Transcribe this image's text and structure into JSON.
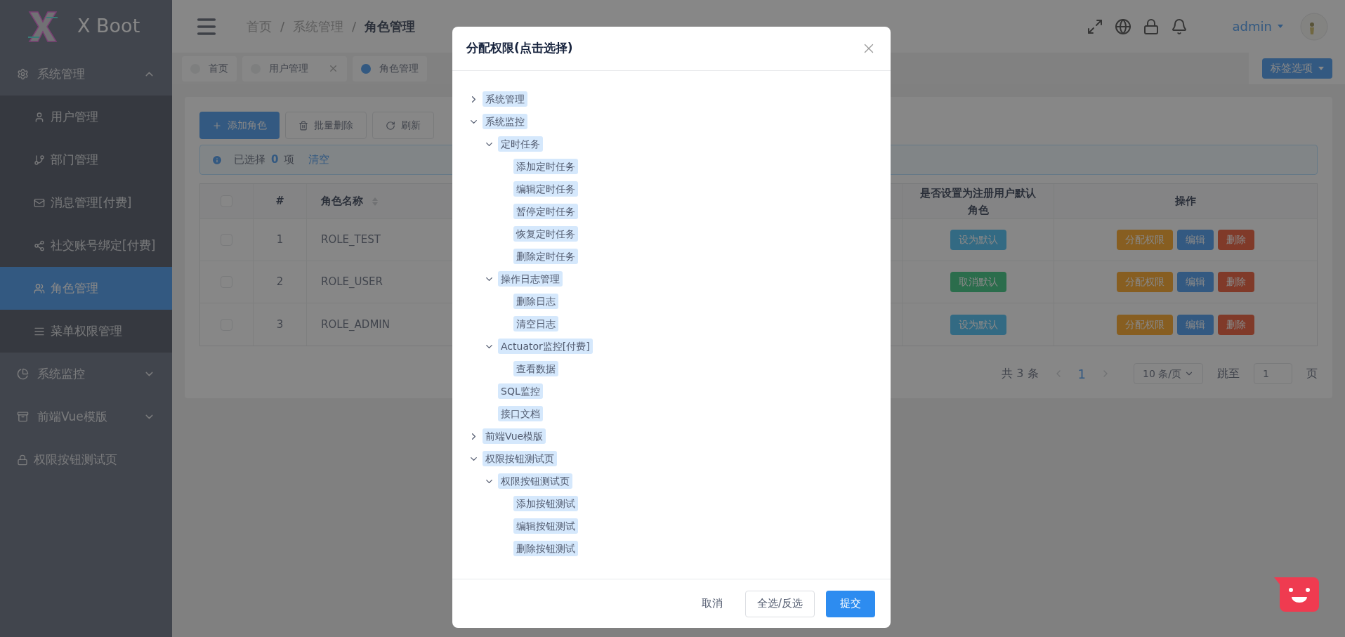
{
  "sidebar": {
    "logo": "X Boot",
    "items": [
      {
        "kind": "group",
        "label": "系统管理",
        "expanded": true,
        "children": [
          {
            "label": "用户管理",
            "selected": false
          },
          {
            "label": "部门管理",
            "selected": false
          },
          {
            "label": "消息管理[付费]",
            "selected": false
          },
          {
            "label": "社交账号绑定[付费]",
            "selected": false
          },
          {
            "label": "角色管理",
            "selected": true
          },
          {
            "label": "菜单权限管理",
            "selected": false
          }
        ]
      },
      {
        "kind": "group",
        "label": "系统监控",
        "expanded": false
      },
      {
        "kind": "group",
        "label": "前端Vue模版",
        "expanded": false
      },
      {
        "kind": "link",
        "label": "权限按钮测试页",
        "selected": false
      }
    ]
  },
  "header": {
    "breadcrumb": [
      "首页",
      "系统管理",
      "角色管理"
    ],
    "separator": "/",
    "user": "admin"
  },
  "tabs": {
    "items": [
      {
        "label": "首页",
        "selected": false,
        "closable": false
      },
      {
        "label": "用户管理",
        "selected": false,
        "closable": true
      },
      {
        "label": "角色管理",
        "selected": true,
        "closable": false
      }
    ],
    "options_button": "标签选项"
  },
  "toolbar": [
    "添加角色",
    "批量删除",
    "刷新"
  ],
  "selection_alert": {
    "prefix": "已选择",
    "count": "0",
    "suffix": "项",
    "clear_link": "清空"
  },
  "table": {
    "select_all": {
      "checked": false
    },
    "columns": [
      "#",
      "角色名称",
      "是否设置为注册用户默认角色",
      "操作"
    ],
    "rows": [
      {
        "checked": false,
        "index": "1",
        "name": "ROLE_TEST",
        "default_button": {
          "label": "设为默认",
          "kind": "set"
        },
        "actions": [
          "分配权限",
          "编辑",
          "删除"
        ]
      },
      {
        "checked": false,
        "index": "2",
        "name": "ROLE_USER",
        "default_button": {
          "label": "取消默认",
          "kind": "cancel"
        },
        "actions": [
          "分配权限",
          "编辑",
          "删除"
        ]
      },
      {
        "checked": false,
        "index": "3",
        "name": "ROLE_ADMIN",
        "default_button": {
          "label": "设为默认",
          "kind": "set"
        },
        "actions": [
          "分配权限",
          "编辑",
          "删除"
        ]
      }
    ]
  },
  "pagination": {
    "total": "共 3 条",
    "page": "1",
    "page_size": "10 条/页",
    "jump_label": "跳至",
    "jump_value": "1",
    "page_suffix": "页"
  },
  "modal": {
    "title": "分配权限(点击选择)",
    "tree": [
      {
        "label": "系统管理",
        "selected": true,
        "expanded": false
      },
      {
        "label": "系统监控",
        "selected": true,
        "expanded": true,
        "children": [
          {
            "label": "定时任务",
            "selected": true,
            "expanded": true,
            "children": [
              {
                "label": "添加定时任务",
                "selected": true
              },
              {
                "label": "编辑定时任务",
                "selected": true
              },
              {
                "label": "暂停定时任务",
                "selected": true
              },
              {
                "label": "恢复定时任务",
                "selected": true
              },
              {
                "label": "删除定时任务",
                "selected": true
              }
            ]
          },
          {
            "label": "操作日志管理",
            "selected": true,
            "expanded": true,
            "children": [
              {
                "label": "删除日志",
                "selected": true
              },
              {
                "label": "清空日志",
                "selected": true
              }
            ]
          },
          {
            "label": "Actuator监控[付费]",
            "selected": true,
            "expanded": true,
            "children": [
              {
                "label": "查看数据",
                "selected": true
              }
            ]
          },
          {
            "label": "SQL监控",
            "selected": true
          },
          {
            "label": "接口文档",
            "selected": true
          }
        ]
      },
      {
        "label": "前端Vue模版",
        "selected": true,
        "expanded": false
      },
      {
        "label": "权限按钮测试页",
        "selected": true,
        "expanded": true,
        "children": [
          {
            "label": "权限按钮测试页",
            "selected": true,
            "expanded": true,
            "children": [
              {
                "label": "添加按钮测试",
                "selected": true
              },
              {
                "label": "编辑按钮测试",
                "selected": true
              },
              {
                "label": "删除按钮测试",
                "selected": true
              }
            ]
          }
        ]
      }
    ],
    "buttons": [
      {
        "label": "取消",
        "kind": "text"
      },
      {
        "label": "全选/反选",
        "kind": "default"
      },
      {
        "label": "提交",
        "kind": "primary"
      }
    ]
  }
}
